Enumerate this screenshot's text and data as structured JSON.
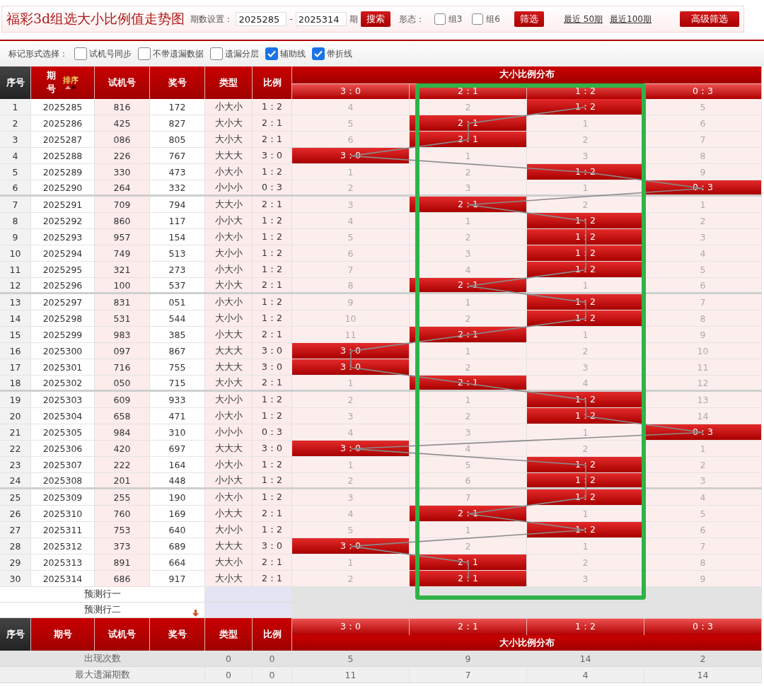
{
  "page_title": "福彩3d组选大小比例值走势图",
  "period_filter": {
    "label": "期数设置：",
    "from": "2025285",
    "separator": "-",
    "to": "2025314",
    "unit": "期",
    "search_button": "搜索"
  },
  "shape_filter": {
    "label": "形态：",
    "options": [
      {
        "label": "组3",
        "checked": false
      },
      {
        "label": "组6",
        "checked": false
      }
    ],
    "filter_button": "筛选"
  },
  "recent_links": [
    "最近 50期",
    "最近100期"
  ],
  "advanced_button": "高级筛选",
  "marker_options": {
    "label": "标记形式选择：",
    "options": [
      {
        "kind": "sync",
        "label": "试机号同步",
        "checked": false
      },
      {
        "kind": "no-miss",
        "label": "不带遗漏数据",
        "checked": false
      },
      {
        "kind": "layer",
        "label": "遗漏分层",
        "checked": false
      },
      {
        "kind": "guide",
        "label": "辅助线",
        "checked": true
      },
      {
        "kind": "polyline",
        "label": "带折线",
        "checked": true
      }
    ]
  },
  "table": {
    "columns": [
      "序号",
      "期号",
      "试机号",
      "奖号",
      "类型",
      "比例"
    ],
    "sort_label": "排序",
    "distribution_title": "大小比例分布",
    "distribution_columns": [
      "3：0",
      "2：1",
      "1：2",
      "0：3"
    ],
    "rows": [
      {
        "index": "1",
        "period": "2025285",
        "trial": "816",
        "draw": "172",
        "type": "小大小",
        "ratio": "1：2",
        "dist": [
          {
            "text": "4",
            "hit": false
          },
          {
            "text": "2",
            "hit": false
          },
          {
            "text": "1：2",
            "hit": true
          },
          {
            "text": "5",
            "hit": false
          }
        ]
      },
      {
        "index": "2",
        "period": "2025286",
        "trial": "425",
        "draw": "827",
        "type": "大小大",
        "ratio": "2：1",
        "dist": [
          {
            "text": "5",
            "hit": false
          },
          {
            "text": "2：1",
            "hit": true
          },
          {
            "text": "1",
            "hit": false
          },
          {
            "text": "6",
            "hit": false
          }
        ]
      },
      {
        "index": "3",
        "period": "2025287",
        "trial": "086",
        "draw": "805",
        "type": "大小大",
        "ratio": "2：1",
        "dist": [
          {
            "text": "6",
            "hit": false
          },
          {
            "text": "2：1",
            "hit": true
          },
          {
            "text": "2",
            "hit": false
          },
          {
            "text": "7",
            "hit": false
          }
        ]
      },
      {
        "index": "4",
        "period": "2025288",
        "trial": "226",
        "draw": "767",
        "type": "大大大",
        "ratio": "3：0",
        "dist": [
          {
            "text": "3：0",
            "hit": true
          },
          {
            "text": "1",
            "hit": false
          },
          {
            "text": "3",
            "hit": false
          },
          {
            "text": "8",
            "hit": false
          }
        ]
      },
      {
        "index": "5",
        "period": "2025289",
        "trial": "330",
        "draw": "473",
        "type": "小大小",
        "ratio": "1：2",
        "dist": [
          {
            "text": "1",
            "hit": false
          },
          {
            "text": "2",
            "hit": false
          },
          {
            "text": "1：2",
            "hit": true
          },
          {
            "text": "9",
            "hit": false
          }
        ]
      },
      {
        "index": "6",
        "period": "2025290",
        "trial": "264",
        "draw": "332",
        "type": "小小小",
        "ratio": "0：3",
        "dist": [
          {
            "text": "2",
            "hit": false
          },
          {
            "text": "3",
            "hit": false
          },
          {
            "text": "1",
            "hit": false
          },
          {
            "text": "0：3",
            "hit": true
          }
        ]
      },
      {
        "index": "7",
        "period": "2025291",
        "trial": "709",
        "draw": "794",
        "type": "大大小",
        "ratio": "2：1",
        "dist": [
          {
            "text": "3",
            "hit": false
          },
          {
            "text": "2：1",
            "hit": true
          },
          {
            "text": "2",
            "hit": false
          },
          {
            "text": "1",
            "hit": false
          }
        ]
      },
      {
        "index": "8",
        "period": "2025292",
        "trial": "860",
        "draw": "117",
        "type": "小小大",
        "ratio": "1：2",
        "dist": [
          {
            "text": "4",
            "hit": false
          },
          {
            "text": "1",
            "hit": false
          },
          {
            "text": "1：2",
            "hit": true
          },
          {
            "text": "2",
            "hit": false
          }
        ]
      },
      {
        "index": "9",
        "period": "2025293",
        "trial": "957",
        "draw": "154",
        "type": "小大小",
        "ratio": "1：2",
        "dist": [
          {
            "text": "5",
            "hit": false
          },
          {
            "text": "2",
            "hit": false
          },
          {
            "text": "1：2",
            "hit": true
          },
          {
            "text": "3",
            "hit": false
          }
        ]
      },
      {
        "index": "10",
        "period": "2025294",
        "trial": "749",
        "draw": "513",
        "type": "大小小",
        "ratio": "1：2",
        "dist": [
          {
            "text": "6",
            "hit": false
          },
          {
            "text": "3",
            "hit": false
          },
          {
            "text": "1：2",
            "hit": true
          },
          {
            "text": "4",
            "hit": false
          }
        ]
      },
      {
        "index": "11",
        "period": "2025295",
        "trial": "321",
        "draw": "273",
        "type": "小大小",
        "ratio": "1：2",
        "dist": [
          {
            "text": "7",
            "hit": false
          },
          {
            "text": "4",
            "hit": false
          },
          {
            "text": "1：2",
            "hit": true
          },
          {
            "text": "5",
            "hit": false
          }
        ]
      },
      {
        "index": "12",
        "period": "2025296",
        "trial": "100",
        "draw": "537",
        "type": "大小大",
        "ratio": "2：1",
        "dist": [
          {
            "text": "8",
            "hit": false
          },
          {
            "text": "2：1",
            "hit": true
          },
          {
            "text": "1",
            "hit": false
          },
          {
            "text": "6",
            "hit": false
          }
        ]
      },
      {
        "index": "13",
        "period": "2025297",
        "trial": "831",
        "draw": "051",
        "type": "小大小",
        "ratio": "1：2",
        "dist": [
          {
            "text": "9",
            "hit": false
          },
          {
            "text": "1",
            "hit": false
          },
          {
            "text": "1：2",
            "hit": true
          },
          {
            "text": "7",
            "hit": false
          }
        ]
      },
      {
        "index": "14",
        "period": "2025298",
        "trial": "531",
        "draw": "544",
        "type": "大小小",
        "ratio": "1：2",
        "dist": [
          {
            "text": "10",
            "hit": false
          },
          {
            "text": "2",
            "hit": false
          },
          {
            "text": "1：2",
            "hit": true
          },
          {
            "text": "8",
            "hit": false
          }
        ]
      },
      {
        "index": "15",
        "period": "2025299",
        "trial": "983",
        "draw": "385",
        "type": "小大大",
        "ratio": "2：1",
        "dist": [
          {
            "text": "11",
            "hit": false
          },
          {
            "text": "2：1",
            "hit": true
          },
          {
            "text": "1",
            "hit": false
          },
          {
            "text": "9",
            "hit": false
          }
        ]
      },
      {
        "index": "16",
        "period": "2025300",
        "trial": "097",
        "draw": "867",
        "type": "大大大",
        "ratio": "3：0",
        "dist": [
          {
            "text": "3：0",
            "hit": true
          },
          {
            "text": "1",
            "hit": false
          },
          {
            "text": "2",
            "hit": false
          },
          {
            "text": "10",
            "hit": false
          }
        ]
      },
      {
        "index": "17",
        "period": "2025301",
        "trial": "716",
        "draw": "755",
        "type": "大大大",
        "ratio": "3：0",
        "dist": [
          {
            "text": "3：0",
            "hit": true
          },
          {
            "text": "2",
            "hit": false
          },
          {
            "text": "3",
            "hit": false
          },
          {
            "text": "11",
            "hit": false
          }
        ]
      },
      {
        "index": "18",
        "period": "2025302",
        "trial": "050",
        "draw": "715",
        "type": "大小大",
        "ratio": "2：1",
        "dist": [
          {
            "text": "1",
            "hit": false
          },
          {
            "text": "2：1",
            "hit": true
          },
          {
            "text": "4",
            "hit": false
          },
          {
            "text": "12",
            "hit": false
          }
        ]
      },
      {
        "index": "19",
        "period": "2025303",
        "trial": "609",
        "draw": "933",
        "type": "大小小",
        "ratio": "1：2",
        "dist": [
          {
            "text": "2",
            "hit": false
          },
          {
            "text": "1",
            "hit": false
          },
          {
            "text": "1：2",
            "hit": true
          },
          {
            "text": "13",
            "hit": false
          }
        ]
      },
      {
        "index": "20",
        "period": "2025304",
        "trial": "658",
        "draw": "471",
        "type": "小大小",
        "ratio": "1：2",
        "dist": [
          {
            "text": "3",
            "hit": false
          },
          {
            "text": "2",
            "hit": false
          },
          {
            "text": "1：2",
            "hit": true
          },
          {
            "text": "14",
            "hit": false
          }
        ]
      },
      {
        "index": "21",
        "period": "2025305",
        "trial": "984",
        "draw": "310",
        "type": "小小小",
        "ratio": "0：3",
        "dist": [
          {
            "text": "4",
            "hit": false
          },
          {
            "text": "3",
            "hit": false
          },
          {
            "text": "1",
            "hit": false
          },
          {
            "text": "0：3",
            "hit": true
          }
        ]
      },
      {
        "index": "22",
        "period": "2025306",
        "trial": "420",
        "draw": "697",
        "type": "大大大",
        "ratio": "3：0",
        "dist": [
          {
            "text": "3：0",
            "hit": true
          },
          {
            "text": "4",
            "hit": false
          },
          {
            "text": "2",
            "hit": false
          },
          {
            "text": "1",
            "hit": false
          }
        ]
      },
      {
        "index": "23",
        "period": "2025307",
        "trial": "222",
        "draw": "164",
        "type": "小大小",
        "ratio": "1：2",
        "dist": [
          {
            "text": "1",
            "hit": false
          },
          {
            "text": "5",
            "hit": false
          },
          {
            "text": "1：2",
            "hit": true
          },
          {
            "text": "2",
            "hit": false
          }
        ]
      },
      {
        "index": "24",
        "period": "2025308",
        "trial": "201",
        "draw": "448",
        "type": "小小大",
        "ratio": "1：2",
        "dist": [
          {
            "text": "2",
            "hit": false
          },
          {
            "text": "6",
            "hit": false
          },
          {
            "text": "1：2",
            "hit": true
          },
          {
            "text": "3",
            "hit": false
          }
        ]
      },
      {
        "index": "25",
        "period": "2025309",
        "trial": "255",
        "draw": "190",
        "type": "小大小",
        "ratio": "1：2",
        "dist": [
          {
            "text": "3",
            "hit": false
          },
          {
            "text": "7",
            "hit": false
          },
          {
            "text": "1：2",
            "hit": true
          },
          {
            "text": "4",
            "hit": false
          }
        ]
      },
      {
        "index": "26",
        "period": "2025310",
        "trial": "760",
        "draw": "169",
        "type": "小大大",
        "ratio": "2：1",
        "dist": [
          {
            "text": "4",
            "hit": false
          },
          {
            "text": "2：1",
            "hit": true
          },
          {
            "text": "1",
            "hit": false
          },
          {
            "text": "5",
            "hit": false
          }
        ]
      },
      {
        "index": "27",
        "period": "2025311",
        "trial": "753",
        "draw": "640",
        "type": "大小小",
        "ratio": "1：2",
        "dist": [
          {
            "text": "5",
            "hit": false
          },
          {
            "text": "1",
            "hit": false
          },
          {
            "text": "1：2",
            "hit": true
          },
          {
            "text": "6",
            "hit": false
          }
        ]
      },
      {
        "index": "28",
        "period": "2025312",
        "trial": "373",
        "draw": "689",
        "type": "大大大",
        "ratio": "3：0",
        "dist": [
          {
            "text": "3：0",
            "hit": true
          },
          {
            "text": "2",
            "hit": false
          },
          {
            "text": "1",
            "hit": false
          },
          {
            "text": "7",
            "hit": false
          }
        ]
      },
      {
        "index": "29",
        "period": "2025313",
        "trial": "891",
        "draw": "664",
        "type": "大大小",
        "ratio": "2：1",
        "dist": [
          {
            "text": "1",
            "hit": false
          },
          {
            "text": "2：1",
            "hit": true
          },
          {
            "text": "2",
            "hit": false
          },
          {
            "text": "8",
            "hit": false
          }
        ]
      },
      {
        "index": "30",
        "period": "2025314",
        "trial": "686",
        "draw": "917",
        "type": "大小大",
        "ratio": "2：1",
        "dist": [
          {
            "text": "2",
            "hit": false
          },
          {
            "text": "2：1",
            "hit": true
          },
          {
            "text": "3",
            "hit": false
          },
          {
            "text": "9",
            "hit": false
          }
        ]
      }
    ],
    "forecast_rows": [
      "预测行一",
      "预测行二"
    ],
    "footer_header": {
      "columns": [
        "序号",
        "期号",
        "试机号",
        "奖号",
        "类型",
        "比例"
      ],
      "distribution_columns": [
        "3：0",
        "2：1",
        "1：2",
        "0：3"
      ],
      "distribution_title": "大小比例分布"
    },
    "stats": [
      {
        "label": "出现次数",
        "values": [
          "0",
          "0",
          "5",
          "9",
          "14",
          "2"
        ]
      },
      {
        "label": "最大遗漏期数",
        "values": [
          "0",
          "0",
          "11",
          "7",
          "4",
          "14"
        ]
      }
    ]
  }
}
